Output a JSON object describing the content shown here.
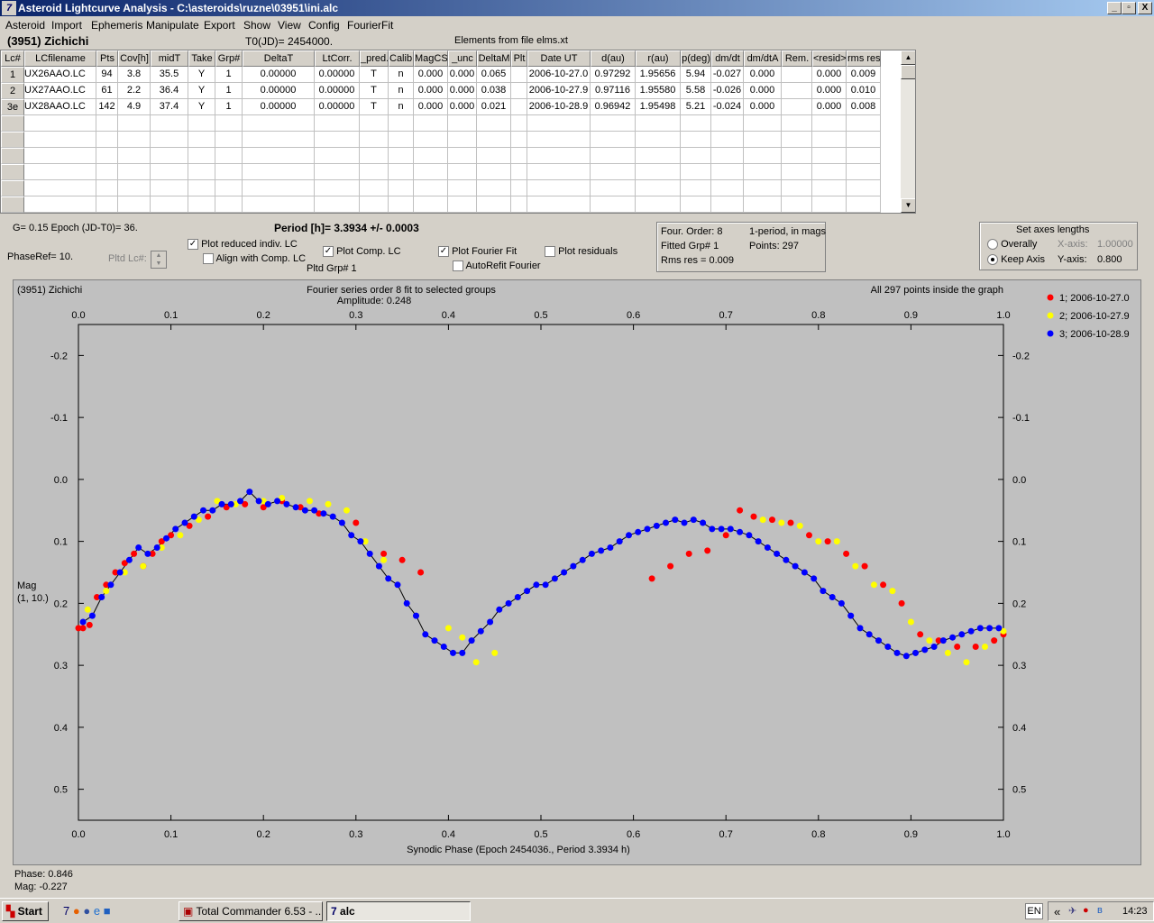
{
  "window": {
    "title": "Asteroid Lightcurve Analysis - C:\\asteroids\\ruzne\\03951\\ini.alc",
    "minimize": "_",
    "maximize": "▫",
    "close": "X"
  },
  "menu": [
    "Asteroid",
    "Import",
    "Ephemeris",
    "Manipulate",
    "Export",
    "Show",
    "View",
    "Config",
    "FourierFit"
  ],
  "header": {
    "object": "(3951) Zichichi",
    "t0": "T0(JD)= 2454000.",
    "elements": "Elements from file elms.xt"
  },
  "grid": {
    "columns": [
      "Lc#",
      "LCfilename",
      "Pts",
      "Cov[h]",
      "midT",
      "Take",
      "Grp#",
      "DeltaT",
      "LtCorr.",
      "_pred.",
      "Calib.",
      "MagCS",
      "_unc",
      "DeltaM",
      "Plt",
      "Date UT",
      "d(au)",
      "r(au)",
      "p(deg)",
      "dm/dt",
      "dm/dtA",
      "Rem.",
      "<resid>",
      "rms res"
    ],
    "rows": [
      [
        "1",
        "UX26AAO.LC",
        "94",
        "3.8",
        "35.5",
        "Y",
        "1",
        "0.00000",
        "0.00000",
        "T",
        "n",
        "0.000",
        "0.000",
        "0.065",
        "",
        "2006-10-27.0",
        "0.97292",
        "1.95656",
        "5.94",
        "-0.027",
        "0.000",
        "",
        "0.000",
        "0.009"
      ],
      [
        "2",
        "UX27AAO.LC",
        "61",
        "2.2",
        "36.4",
        "Y",
        "1",
        "0.00000",
        "0.00000",
        "T",
        "n",
        "0.000",
        "0.000",
        "0.038",
        "",
        "2006-10-27.9",
        "0.97116",
        "1.95580",
        "5.58",
        "-0.026",
        "0.000",
        "",
        "0.000",
        "0.010"
      ],
      [
        "3e",
        "UX28AAO.LC",
        "142",
        "4.9",
        "37.4",
        "Y",
        "1",
        "0.00000",
        "0.00000",
        "T",
        "n",
        "0.000",
        "0.000",
        "0.021",
        "",
        "2006-10-28.9",
        "0.96942",
        "1.95498",
        "5.21",
        "-0.024",
        "0.000",
        "",
        "0.000",
        "0.008"
      ]
    ],
    "empty_rows": 6,
    "scroll_up": "▲",
    "scroll_down": "▼"
  },
  "params": {
    "g_epoch": "G= 0.15    Epoch (JD-T0)= 36.",
    "period": "Period [h]= 3.3934 +/- 0.0003",
    "phaseref": "PhaseRef= 10.",
    "pltd_lc": "Pltd Lc#:",
    "pltd_grp": "Pltd Grp#  1"
  },
  "checkboxes": {
    "reduced": {
      "label": "Plot reduced indiv. LC",
      "checked": "✓"
    },
    "align": {
      "label": "Align with Comp. LC",
      "checked": ""
    },
    "comp": {
      "label": "Plot Comp. LC",
      "checked": "✓"
    },
    "fourier": {
      "label": "Plot Fourier Fit",
      "checked": "✓"
    },
    "residuals": {
      "label": "Plot residuals",
      "checked": ""
    },
    "autorefit": {
      "label": "AutoRefit Fourier",
      "checked": ""
    }
  },
  "fourier_box": {
    "order": "Four. Order:  8",
    "period_mode": "1-period, in mags",
    "fitted": "Fitted Grp# 1",
    "points": "Points: 297",
    "rms": "Rms res      = 0.009"
  },
  "axes_box": {
    "title": "Set axes lengths",
    "overally": "Overally",
    "keep": "Keep Axis",
    "xaxis_label": "X-axis:",
    "xaxis_value": "1.00000",
    "yaxis_label": "Y-axis:",
    "yaxis_value": "0.800"
  },
  "chart_data": {
    "type": "scatter",
    "title": "(3951) Zichichi",
    "subtitle": "Fourier series order 8 fit to selected groups",
    "amplitude": "Amplitude: 0.248",
    "inside": "All 297 points inside the graph",
    "xlabel": "Synodic Phase (Epoch 2454036., Period 3.3934 h)",
    "ylabel": "Mag",
    "ylabel2": "(1, 10.)",
    "xlim": [
      0,
      1
    ],
    "ylim": [
      -0.25,
      0.55
    ],
    "y_inverted": true,
    "xticks": [
      "0.0",
      "0.1",
      "0.2",
      "0.3",
      "0.4",
      "0.5",
      "0.6",
      "0.7",
      "0.8",
      "0.9",
      "1.0"
    ],
    "yticks": [
      "-0.2",
      "-0.1",
      "0.0",
      "0.1",
      "0.2",
      "0.3",
      "0.4",
      "0.5"
    ],
    "ytick_values": [
      -0.2,
      -0.1,
      0.0,
      0.1,
      0.2,
      0.3,
      0.4,
      0.5
    ],
    "series": [
      {
        "name": "1; 2006-10-27.0",
        "color": "#ff0000",
        "x": [
          0.0,
          0.005,
          0.012,
          0.02,
          0.03,
          0.04,
          0.05,
          0.06,
          0.07,
          0.08,
          0.09,
          0.1,
          0.12,
          0.14,
          0.16,
          0.18,
          0.2,
          0.22,
          0.24,
          0.26,
          0.3,
          0.33,
          0.35,
          0.37,
          0.62,
          0.64,
          0.66,
          0.68,
          0.7,
          0.715,
          0.73,
          0.75,
          0.77,
          0.79,
          0.81,
          0.83,
          0.85,
          0.87,
          0.89,
          0.91,
          0.93,
          0.95,
          0.97,
          0.99,
          1.0
        ],
        "y": [
          0.24,
          0.24,
          0.235,
          0.19,
          0.17,
          0.15,
          0.135,
          0.12,
          0.14,
          0.12,
          0.1,
          0.09,
          0.075,
          0.06,
          0.045,
          0.04,
          0.045,
          0.035,
          0.045,
          0.055,
          0.07,
          0.12,
          0.13,
          0.15,
          0.16,
          0.14,
          0.12,
          0.115,
          0.09,
          0.05,
          0.06,
          0.065,
          0.07,
          0.09,
          0.1,
          0.12,
          0.14,
          0.17,
          0.2,
          0.25,
          0.26,
          0.27,
          0.27,
          0.26,
          0.25
        ]
      },
      {
        "name": "2; 2006-10-27.9",
        "color": "#ffff00",
        "x": [
          0.01,
          0.03,
          0.05,
          0.07,
          0.09,
          0.11,
          0.13,
          0.15,
          0.17,
          0.2,
          0.22,
          0.25,
          0.27,
          0.29,
          0.31,
          0.33,
          0.4,
          0.415,
          0.43,
          0.45,
          0.74,
          0.76,
          0.78,
          0.8,
          0.82,
          0.84,
          0.86,
          0.88,
          0.9,
          0.92,
          0.94,
          0.96,
          0.98,
          1.0
        ],
        "y": [
          0.21,
          0.18,
          0.15,
          0.14,
          0.11,
          0.09,
          0.065,
          0.035,
          0.04,
          0.035,
          0.03,
          0.035,
          0.04,
          0.05,
          0.1,
          0.13,
          0.24,
          0.255,
          0.295,
          0.28,
          0.065,
          0.07,
          0.075,
          0.1,
          0.1,
          0.14,
          0.17,
          0.18,
          0.23,
          0.26,
          0.28,
          0.295,
          0.27,
          0.245
        ]
      },
      {
        "name": "3; 2006-10-28.9",
        "color": "#0000ff",
        "x": [
          0.005,
          0.015,
          0.025,
          0.035,
          0.045,
          0.055,
          0.065,
          0.075,
          0.085,
          0.095,
          0.105,
          0.115,
          0.125,
          0.135,
          0.145,
          0.155,
          0.165,
          0.175,
          0.185,
          0.195,
          0.205,
          0.215,
          0.225,
          0.235,
          0.245,
          0.255,
          0.265,
          0.275,
          0.285,
          0.295,
          0.305,
          0.315,
          0.325,
          0.335,
          0.345,
          0.355,
          0.365,
          0.375,
          0.385,
          0.395,
          0.405,
          0.415,
          0.425,
          0.435,
          0.445,
          0.455,
          0.465,
          0.475,
          0.485,
          0.495,
          0.505,
          0.515,
          0.525,
          0.535,
          0.545,
          0.555,
          0.565,
          0.575,
          0.585,
          0.595,
          0.605,
          0.615,
          0.625,
          0.635,
          0.645,
          0.655,
          0.665,
          0.675,
          0.685,
          0.695,
          0.705,
          0.715,
          0.725,
          0.735,
          0.745,
          0.755,
          0.765,
          0.775,
          0.785,
          0.795,
          0.805,
          0.815,
          0.825,
          0.835,
          0.845,
          0.855,
          0.865,
          0.875,
          0.885,
          0.895,
          0.905,
          0.915,
          0.925,
          0.935,
          0.945,
          0.955,
          0.965,
          0.975,
          0.985,
          0.995
        ],
        "y": [
          0.23,
          0.22,
          0.19,
          0.17,
          0.15,
          0.13,
          0.11,
          0.12,
          0.11,
          0.095,
          0.08,
          0.07,
          0.06,
          0.05,
          0.05,
          0.04,
          0.04,
          0.035,
          0.02,
          0.035,
          0.04,
          0.035,
          0.04,
          0.045,
          0.05,
          0.05,
          0.055,
          0.06,
          0.07,
          0.09,
          0.1,
          0.12,
          0.14,
          0.16,
          0.17,
          0.2,
          0.22,
          0.25,
          0.26,
          0.27,
          0.28,
          0.28,
          0.26,
          0.245,
          0.23,
          0.21,
          0.2,
          0.19,
          0.18,
          0.17,
          0.17,
          0.16,
          0.15,
          0.14,
          0.13,
          0.12,
          0.115,
          0.11,
          0.1,
          0.09,
          0.085,
          0.08,
          0.075,
          0.07,
          0.065,
          0.07,
          0.065,
          0.07,
          0.08,
          0.08,
          0.08,
          0.085,
          0.09,
          0.1,
          0.11,
          0.12,
          0.13,
          0.14,
          0.15,
          0.16,
          0.18,
          0.19,
          0.2,
          0.22,
          0.24,
          0.25,
          0.26,
          0.27,
          0.28,
          0.285,
          0.28,
          0.275,
          0.27,
          0.26,
          0.255,
          0.25,
          0.245,
          0.24,
          0.24,
          0.24
        ]
      }
    ],
    "fit_color": "#000000"
  },
  "readout": {
    "phase": "Phase:  0.846",
    "mag": "Mag:    -0.227"
  },
  "taskbar": {
    "start": "Start",
    "tasks": [
      "Total Commander 6.53 - ...",
      "alc"
    ],
    "lang": "EN",
    "tray_arrow": "«",
    "clock": "14:23"
  }
}
